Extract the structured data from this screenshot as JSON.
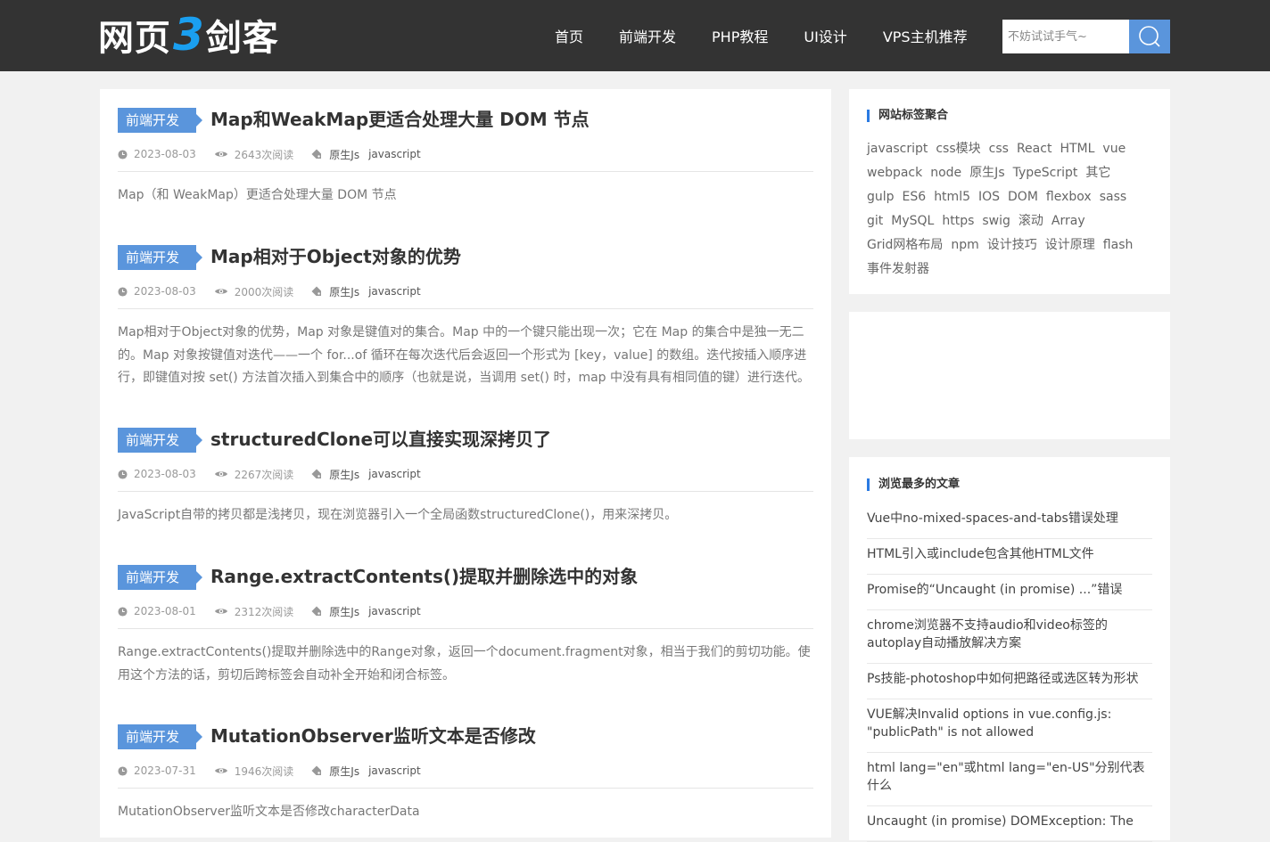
{
  "header": {
    "logo_part1": "网页",
    "logo_part2": "3",
    "logo_part3": "剑客",
    "nav": [
      "首页",
      "前端开发",
      "PHP教程",
      "UI设计",
      "VPS主机推荐"
    ],
    "search_placeholder": "不妨试试手气~"
  },
  "articles": [
    {
      "category": "前端开发",
      "title": "Map和WeakMap更适合处理大量 DOM 节点",
      "date": "2023-08-03",
      "views": "2643次阅读",
      "tags": [
        "原生Js",
        "javascript"
      ],
      "excerpt": "Map（和 WeakMap）更适合处理大量 DOM 节点"
    },
    {
      "category": "前端开发",
      "title": "Map相对于Object对象的优势",
      "date": "2023-08-03",
      "views": "2000次阅读",
      "tags": [
        "原生Js",
        "javascript"
      ],
      "excerpt": "Map相对于Object对象的优势，Map 对象是键值对的集合。Map 中的一个键只能出现一次；它在 Map 的集合中是独一无二的。Map 对象按键值对迭代——一个 for...of 循环在每次迭代后会返回一个形式为 [key，value] 的数组。迭代按插入顺序进行，即键值对按 set() 方法首次插入到集合中的顺序（也就是说，当调用 set() 时，map 中没有具有相同值的键）进行迭代。"
    },
    {
      "category": "前端开发",
      "title": "structuredClone可以直接实现深拷贝了",
      "date": "2023-08-03",
      "views": "2267次阅读",
      "tags": [
        "原生Js",
        "javascript"
      ],
      "excerpt": "JavaScript自带的拷贝都是浅拷贝，现在浏览器引入一个全局函数structuredClone()，用来深拷贝。"
    },
    {
      "category": "前端开发",
      "title": "Range.extractContents()提取并删除选中的对象",
      "date": "2023-08-01",
      "views": "2312次阅读",
      "tags": [
        "原生Js",
        "javascript"
      ],
      "excerpt": "Range.extractContents()提取并删除选中的Range对象，返回一个document.fragment对象，相当于我们的剪切功能。使用这个方法的话，剪切后跨标签会自动补全开始和闭合标签。"
    },
    {
      "category": "前端开发",
      "title": "MutationObserver监听文本是否修改",
      "date": "2023-07-31",
      "views": "1946次阅读",
      "tags": [
        "原生Js",
        "javascript"
      ],
      "excerpt": "MutationObserver监听文本是否修改characterData"
    }
  ],
  "sidebar": {
    "tags_title": "网站标签聚合",
    "tags": [
      "javascript",
      "css模块",
      "css",
      "React",
      "HTML",
      "vue",
      "webpack",
      "node",
      "原生Js",
      "TypeScript",
      "其它",
      "gulp",
      "ES6",
      "html5",
      "IOS",
      "DOM",
      "flexbox",
      "sass",
      "git",
      "MySQL",
      "https",
      "swig",
      "滚动",
      "Array",
      "Grid网格布局",
      "npm",
      "设计技巧",
      "设计原理",
      "flash",
      "事件发射器"
    ],
    "popular_title": "浏览最多的文章",
    "popular": [
      "Vue中no-mixed-spaces-and-tabs错误处理",
      "HTML引入或include包含其他HTML文件",
      "Promise的“Uncaught (in promise) ...”错误",
      "chrome浏览器不支持audio和video标签的autoplay自动播放解决方案",
      "Ps技能-photoshop中如何把路径或选区转为形状",
      "VUE解决Invalid options in vue.config.js: \"publicPath\" is not allowed",
      "html lang=\"en\"或html lang=\"en-US\"分别代表什么",
      "Uncaught (in promise) DOMException: The"
    ]
  }
}
